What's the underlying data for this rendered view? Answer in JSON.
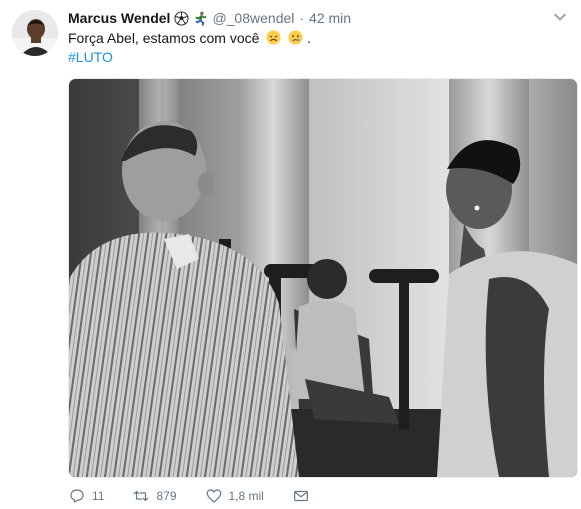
{
  "tweet": {
    "display_name": "Marcus Wendel",
    "badge_icons": [
      "soccer-ball-icon",
      "runner-icon"
    ],
    "handle": "@_08wendel",
    "separator": "·",
    "time": "42 min",
    "text": "Força Abel, estamos com você",
    "text_emojis": [
      "tired-face-icon",
      "crying-face-icon"
    ],
    "text_end": ".",
    "hashtag": "#LUTO"
  },
  "media": {
    "alt": "photo"
  },
  "actions": {
    "reply_count": "11",
    "retweet_count": "879",
    "like_count": "1,8 mil"
  },
  "colors": {
    "link": "#1b95e0",
    "muted": "#657786",
    "text": "#14171a"
  }
}
